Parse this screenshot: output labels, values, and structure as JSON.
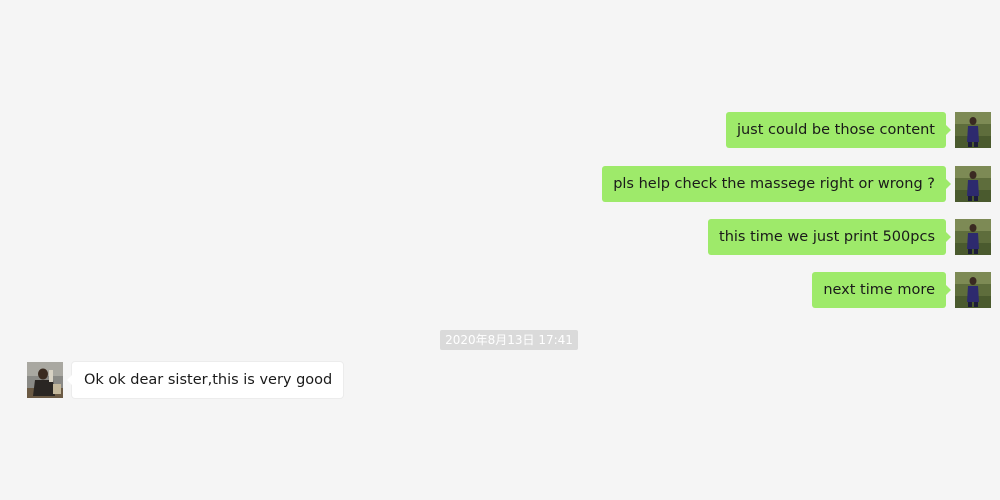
{
  "chat": {
    "outgoing": [
      {
        "text": "just could be those content",
        "avatar": "user-photo-avatar"
      },
      {
        "text": "pls help check the massege right or wrong ?",
        "avatar": "user-photo-avatar"
      },
      {
        "text": "this time we just print 500pcs",
        "avatar": "user-photo-avatar"
      },
      {
        "text": "next time more",
        "avatar": "user-photo-avatar"
      }
    ],
    "timestamp": "2020年8月13日 17:41",
    "incoming": [
      {
        "text": "Ok ok dear sister,this is very good",
        "avatar": "contact-photo-avatar"
      }
    ]
  },
  "colors": {
    "background": "#f5f5f5",
    "outgoing_bubble": "#9eea6a",
    "incoming_bubble": "#ffffff",
    "timestamp_bg": "#dadada",
    "timestamp_text": "#ffffff"
  }
}
